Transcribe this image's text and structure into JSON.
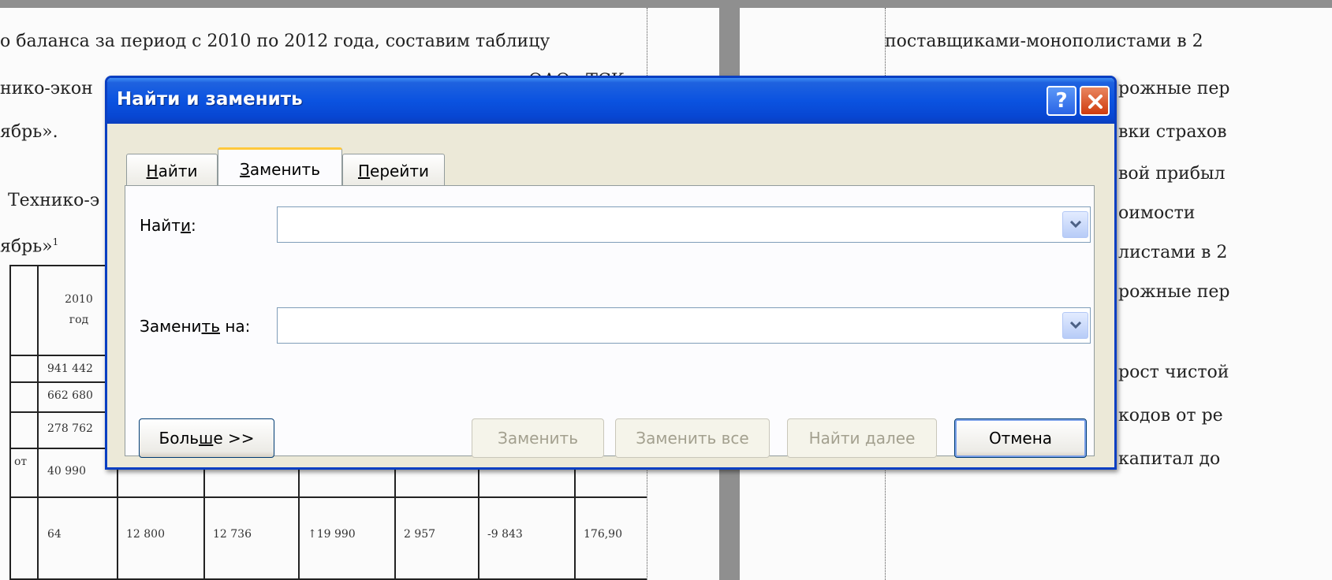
{
  "document_left": {
    "line1": "о баланса за период с 2010 по 2012 года, составим таблицу",
    "line2": "нико-экон",
    "line2_right": "ОАО «ТСК",
    "line3": "ябрь».",
    "line4": "Технико-э",
    "line5": "ябрь»",
    "line5_sup": "1",
    "table_header_year": "2010",
    "table_header_unit": "год",
    "rows": [
      "941 442",
      "662 680",
      "278 762",
      "40 990",
      "64"
    ],
    "row4_label": "от",
    "bottom_row": [
      "64",
      "12 800",
      "12 736",
      "↑19 990",
      "2 957",
      "-9 843",
      "176,90"
    ]
  },
  "document_right": {
    "lines": [
      "поставщиками-монополистами в 2",
      "рожные пер",
      "вки страхов",
      "вой прибыл",
      "оимости",
      "листами в 2",
      "рожные пер",
      "рост чистой",
      "кодов от ре",
      "капитал до"
    ]
  },
  "dialog": {
    "title": "Найти и заменить",
    "help_label": "?",
    "tabs": [
      {
        "label_pre": "",
        "label_u": "Н",
        "label_post": "айти"
      },
      {
        "label_pre": "",
        "label_u": "З",
        "label_post": "аменить"
      },
      {
        "label_pre": "",
        "label_u": "П",
        "label_post": "ерейти"
      }
    ],
    "find_label_pre": "Найт",
    "find_label_u": "и",
    "find_label_post": ":",
    "find_value": "",
    "replace_label_pre": "Замени",
    "replace_label_u": "ть",
    "replace_label_post": " на:",
    "replace_value": "",
    "more_pre": "Боль",
    "more_u": "ш",
    "more_post": "е >>",
    "replace_button": "Заменить",
    "replace_all_button": "Заменить все",
    "find_next_button": "Найти далее",
    "cancel_button": "Отмена"
  },
  "colors": {
    "title_bar": "#0b53e0",
    "dialog_bg": "#ece9d8",
    "active_tab_accent": "#ffc83c",
    "close_button": "#cf3b0e"
  }
}
